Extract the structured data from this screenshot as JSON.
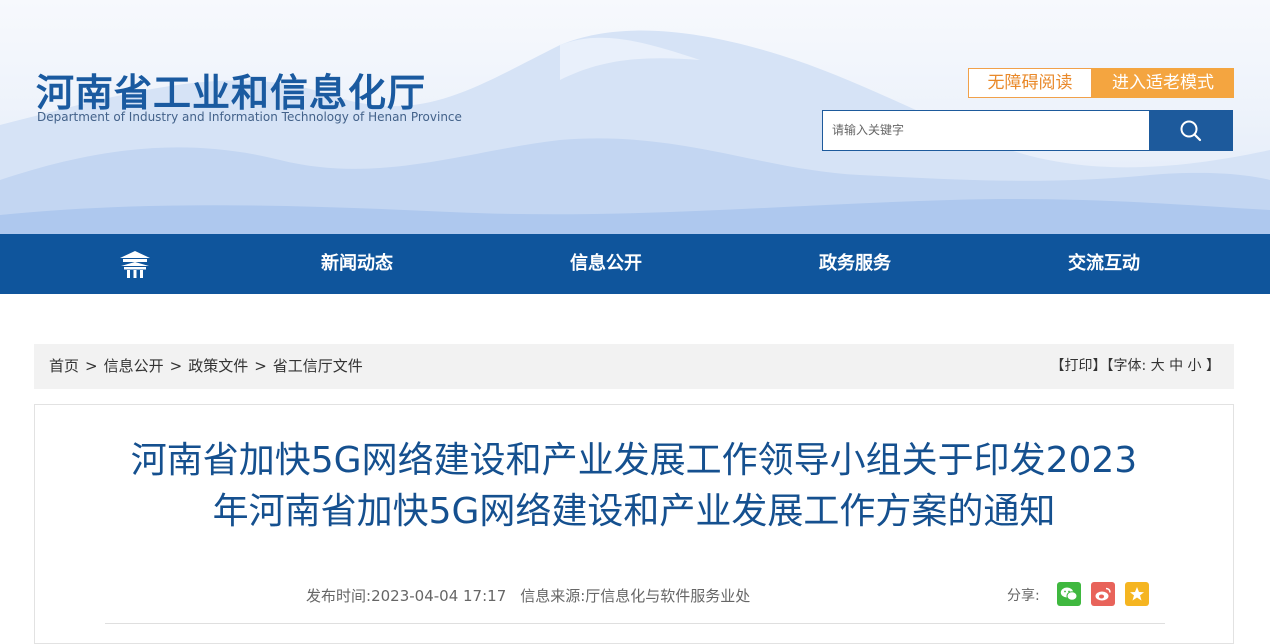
{
  "header": {
    "site_title": "河南省工业和信息化厅",
    "site_subtitle": "Department of Industry and Information Technology of Henan Province",
    "accessibility_button": "无障碍阅读",
    "elder_mode_button": "进入适老模式",
    "search": {
      "placeholder": "请输入关键字"
    }
  },
  "nav": {
    "items": [
      {
        "label": "新闻动态"
      },
      {
        "label": "信息公开"
      },
      {
        "label": "政务服务"
      },
      {
        "label": "交流互动"
      }
    ]
  },
  "breadcrumb": {
    "items": [
      "首页",
      "信息公开",
      "政策文件",
      "省工信厅文件"
    ],
    "separator": ">"
  },
  "tools": {
    "print": "【打印】",
    "font_prefix": "【字体:",
    "font_large": "大",
    "font_medium": "中",
    "font_small": "小",
    "font_suffix": "】"
  },
  "article": {
    "title_line1": "河南省加快5G网络建设和产业发展工作领导小组关于印发2023",
    "title_line2": "年河南省加快5G网络建设和产业发展工作方案的通知",
    "publish_label": "发布时间:",
    "publish_time": "2023-04-04 17:17",
    "source_label": "信息来源:",
    "source": "厅信息化与软件服务业处",
    "share_label": "分享:"
  },
  "colors": {
    "brand_blue": "#0f559c",
    "title_blue": "#15508f",
    "accent_orange": "#f4a540",
    "wechat_green": "#3fb83f",
    "weibo_red": "#e8635a",
    "qzone_yellow": "#f5b521"
  }
}
